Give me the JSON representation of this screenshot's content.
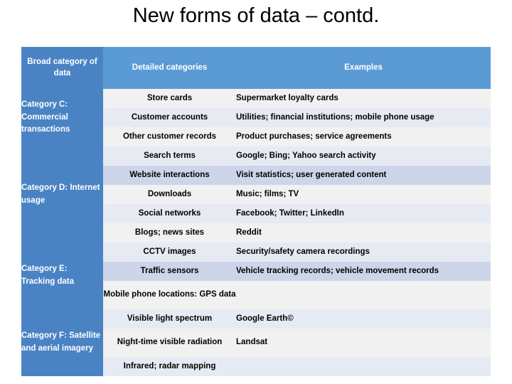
{
  "slide": {
    "title": "New forms of data – contd."
  },
  "colors": {
    "header_first": "#4a83c4",
    "header_rest": "#5b9bd5",
    "category_cell": "#4a83c4",
    "row_light": "#f1f1f1",
    "row_mid": "#e6eaf3",
    "row_dark": "#ccd5e9",
    "title_text": "#000000",
    "header_text": "#ffffff",
    "body_text": "#000000"
  },
  "table": {
    "headers": [
      "Broad category of data",
      "Detailed categories",
      "Examples"
    ],
    "groups": [
      {
        "category": "Category C: Commercial transactions",
        "rows": [
          {
            "detailed": "Store cards",
            "example": "Supermarket loyalty cards"
          },
          {
            "detailed": "Customer accounts",
            "example": "Utilities; financial institutions; mobile phone usage"
          },
          {
            "detailed": "Other customer records",
            "example": "Product purchases; service agreements"
          }
        ]
      },
      {
        "category": "Category D: Internet usage",
        "rows": [
          {
            "detailed": "Search terms",
            "example": "Google; Bing; Yahoo search activity"
          },
          {
            "detailed": "Website interactions",
            "example": "Visit statistics; user generated content"
          },
          {
            "detailed": "Downloads",
            "example": "Music; films; TV"
          },
          {
            "detailed": "Social networks",
            "example": "Facebook; Twitter; LinkedIn"
          },
          {
            "detailed": "Blogs; news sites",
            "example": "Reddit"
          }
        ]
      },
      {
        "category": "Category E: Tracking data",
        "rows": [
          {
            "detailed": "CCTV images",
            "example": "Security/safety camera recordings"
          },
          {
            "detailed": "Traffic sensors",
            "example": "Vehicle tracking records; vehicle movement records"
          },
          {
            "detailed": "Mobile phone locations: GPS data",
            "example": ""
          }
        ]
      },
      {
        "category": "Category F: Satellite and aerial imagery",
        "rows": [
          {
            "detailed": "Visible light spectrum",
            "example": "Google Earth©"
          },
          {
            "detailed": "Night-time visible radiation",
            "example": "Landsat"
          },
          {
            "detailed": "Infrared; radar mapping",
            "example": ""
          }
        ]
      }
    ]
  }
}
